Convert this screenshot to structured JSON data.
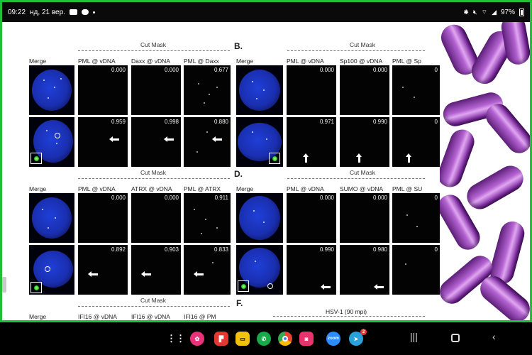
{
  "status_bar": {
    "time": "09:22",
    "date": "нд, 21 вер.",
    "battery": "97%"
  },
  "figure": {
    "panels": [
      {
        "label": "",
        "cut_mask": "Cut Mask",
        "headers": [
          "Merge",
          "PML @ vDNA",
          "Daxx @ vDNA",
          "PML @ Daxx"
        ],
        "rows": [
          [
            "0.000",
            "0.000",
            "0.677"
          ],
          [
            "0.959",
            "0.998",
            "0.880"
          ]
        ]
      },
      {
        "label": "B.",
        "cut_mask": "Cut Mask",
        "headers": [
          "Merge",
          "PML @ vDNA",
          "Sp100 @ vDNA",
          "PML @ Sp"
        ],
        "rows": [
          [
            "0.000",
            "0.000",
            "0"
          ],
          [
            "0.971",
            "0.990",
            "0"
          ]
        ]
      },
      {
        "label": "",
        "cut_mask": "Cut Mask",
        "headers": [
          "Merge",
          "PML @ vDNA",
          "ATRX @ vDNA",
          "PML @ ATRX"
        ],
        "rows": [
          [
            "0.000",
            "0.000",
            "0.911"
          ],
          [
            "0.892",
            "0.903",
            "0.833"
          ]
        ]
      },
      {
        "label": "D.",
        "cut_mask": "Cut Mask",
        "headers": [
          "Merge",
          "PML @ vDNA",
          "SUMO @ vDNA",
          "PML @ SU"
        ],
        "rows": [
          [
            "0.000",
            "0.000",
            "0"
          ],
          [
            "0.990",
            "0.980",
            "0"
          ]
        ]
      }
    ],
    "bottom": {
      "cut_mask": "Cut Mask",
      "left_headers": [
        "Merge",
        "IFI16 @ vDNA",
        "IFI16 @ vDNA",
        "IFI16 @ PM"
      ],
      "f_label": "F.",
      "hsv_label": "HSV-1 (90 mpi)"
    }
  },
  "nav": {
    "apps": [
      "apps-grid",
      "flower-app",
      "flipboard",
      "notes",
      "phone",
      "chrome",
      "screen-recorder",
      "zoom",
      "telegram"
    ],
    "zoom_label": "zoom",
    "telegram_badge": "2",
    "colors": {
      "frame": "#1fbf3a",
      "nucleus": "#1a2fb0",
      "bacteria": "#a855c8"
    }
  }
}
